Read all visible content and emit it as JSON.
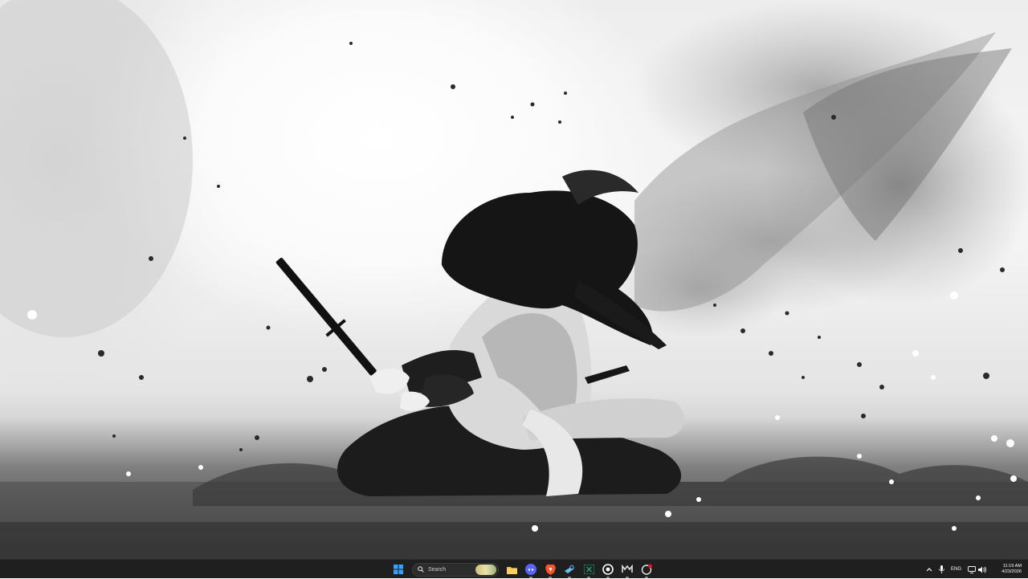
{
  "desktop": {
    "wallpaper": "samurai-ink-wash-wallpaper"
  },
  "taskbar": {
    "start_icon": "windows-start-icon",
    "search": {
      "placeholder": "Search",
      "icon": "search-icon"
    },
    "pinned_apps": [
      {
        "name": "file-explorer",
        "icon": "folder-icon",
        "running": false
      },
      {
        "name": "discord",
        "icon": "discord-icon",
        "running": true
      },
      {
        "name": "brave-browser",
        "icon": "brave-icon",
        "running": true
      },
      {
        "name": "steam",
        "icon": "steam-icon",
        "running": true
      },
      {
        "name": "excel",
        "icon": "excel-icon",
        "running": true
      },
      {
        "name": "chrome-like",
        "icon": "browser-icon",
        "running": true
      },
      {
        "name": "epic-games",
        "icon": "epic-icon",
        "running": true
      },
      {
        "name": "app-with-badge",
        "icon": "badge-app-icon",
        "running": true
      }
    ],
    "tray": {
      "language": "ENG",
      "time": "11:19 AM",
      "date": "4/23/2026"
    }
  },
  "colors": {
    "taskbar_bg": "#1f1f1f",
    "accent_blue": "#3aa0ff",
    "brave_orange": "#fb542b",
    "discord_purple": "#5865f2"
  }
}
